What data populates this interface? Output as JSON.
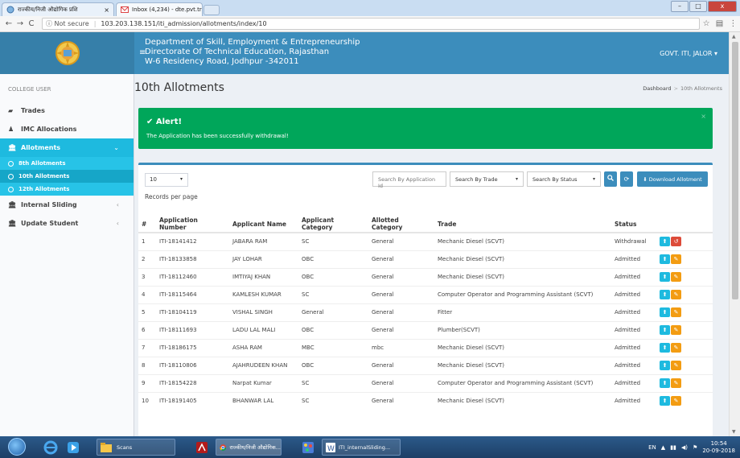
{
  "browser": {
    "tabs": [
      {
        "title": "राज्कीय/निजी औद्योगिक प्रशि",
        "close": "×"
      },
      {
        "title": "Inbox (4,234) - dte.pvt.tra",
        "close": "×"
      }
    ],
    "window_buttons": {
      "min": "–",
      "max": "□",
      "close": "x"
    },
    "nav": {
      "back": "←",
      "forward": "→",
      "reload": "C"
    },
    "security": "ⓘ Not secure",
    "url": "103.203.138.151/iti_admission/allotments/index/10",
    "star": "☆",
    "menu": "⋮",
    "ext": "▤"
  },
  "header": {
    "org_line1": "Department of Skill, Employment & Entrepreneurship",
    "org_line2": "Directorate Of Technical Education, Rajasthan",
    "org_line3": "W-6 Residency Road, Jodhpur -342011",
    "user_menu": "GOVT. ITI, JALOR ▾",
    "hamburger": "≡"
  },
  "sidebar": {
    "header": "COLLEGE USER",
    "items": [
      {
        "label": "Trades",
        "icon": "▰"
      },
      {
        "label": "IMC Allocations",
        "icon": "♟"
      },
      {
        "label": "Allotments",
        "icon": "🏛",
        "chev": "⌄"
      },
      {
        "label": "Internal Sliding",
        "icon": "🏛",
        "chev": "‹"
      },
      {
        "label": "Update Student",
        "icon": "🏛",
        "chev": "‹"
      }
    ],
    "subitems": [
      "8th Allotments",
      "10th Allotments",
      "12th Allotments"
    ]
  },
  "page": {
    "title": "10th Allotments",
    "breadcrumb_home": "Dashboard",
    "breadcrumb_sep": ">",
    "breadcrumb_current": "10th Allotments"
  },
  "alert": {
    "title": "✔ Alert!",
    "message": "The Application has been successfully withdrawal!",
    "close": "×"
  },
  "controls": {
    "page_length": "10",
    "records_per_page": "Records per page",
    "search_app_placeholder": "Search By Application Id",
    "search_trade": "Search By Trade",
    "search_status": "Search By Status",
    "caret": "▾",
    "search_icon": "🔍",
    "refresh_icon": "⟳",
    "download_label": "⬇ Download Allotment"
  },
  "table": {
    "headers": [
      "#",
      "Application Number",
      "Applicant Name",
      "Applicant Category",
      "Allotted Category",
      "Trade",
      "Status"
    ],
    "rows": [
      {
        "n": "1",
        "app": "ITI-18141412",
        "name": "JABARA RAM",
        "cat": "SC",
        "allot": "General",
        "trade": "Mechanic Diesel (SCVT)",
        "status": "Withdrawal",
        "action": "undo"
      },
      {
        "n": "2",
        "app": "ITI-18133858",
        "name": "JAY LOHAR",
        "cat": "OBC",
        "allot": "General",
        "trade": "Mechanic Diesel (SCVT)",
        "status": "Admitted",
        "action": "edit"
      },
      {
        "n": "3",
        "app": "ITI-18112460",
        "name": "IMTIYAJ KHAN",
        "cat": "OBC",
        "allot": "General",
        "trade": "Mechanic Diesel (SCVT)",
        "status": "Admitted",
        "action": "edit"
      },
      {
        "n": "4",
        "app": "ITI-18115464",
        "name": "KAMLESH KUMAR",
        "cat": "SC",
        "allot": "General",
        "trade": "Computer Operator and Programming Assistant (SCVT)",
        "status": "Admitted",
        "action": "edit"
      },
      {
        "n": "5",
        "app": "ITI-18104119",
        "name": "VISHAL SINGH",
        "cat": "General",
        "allot": "General",
        "trade": "Fitter",
        "status": "Admitted",
        "action": "edit"
      },
      {
        "n": "6",
        "app": "ITI-18111693",
        "name": "LADU LAL MALI",
        "cat": "OBC",
        "allot": "General",
        "trade": "Plumber(SCVT)",
        "status": "Admitted",
        "action": "edit"
      },
      {
        "n": "7",
        "app": "ITI-18186175",
        "name": "ASHA RAM",
        "cat": "MBC",
        "allot": "mbc",
        "trade": "Mechanic Diesel (SCVT)",
        "status": "Admitted",
        "action": "edit"
      },
      {
        "n": "8",
        "app": "ITI-18110806",
        "name": "AJAHRUDEEN KHAN",
        "cat": "OBC",
        "allot": "General",
        "trade": "Mechanic Diesel (SCVT)",
        "status": "Admitted",
        "action": "edit"
      },
      {
        "n": "9",
        "app": "ITI-18154228",
        "name": "Narpat Kumar",
        "cat": "SC",
        "allot": "General",
        "trade": "Computer Operator and Programming Assistant (SCVT)",
        "status": "Admitted",
        "action": "edit"
      },
      {
        "n": "10",
        "app": "ITI-18191405",
        "name": "BHANWAR LAL",
        "cat": "SC",
        "allot": "General",
        "trade": "Mechanic Diesel (SCVT)",
        "status": "Admitted",
        "action": "edit"
      }
    ],
    "upload_icon": "⬆",
    "edit_icon": "✎",
    "undo_icon": "↺"
  },
  "taskbar": {
    "tasks": [
      "Scans",
      "राज्कीय/निजी औद्योगिक...",
      "ITI_internalSliding..."
    ],
    "lang": "EN",
    "time": "10:54",
    "date": "20-09-2018"
  },
  "colors": {
    "header": "#3c8dbc",
    "sidebar_active": "#1ebadf",
    "alert_success": "#00a65a",
    "action_blue": "#1ebadf",
    "action_orange": "#f39c12",
    "action_red": "#dd4b39"
  }
}
